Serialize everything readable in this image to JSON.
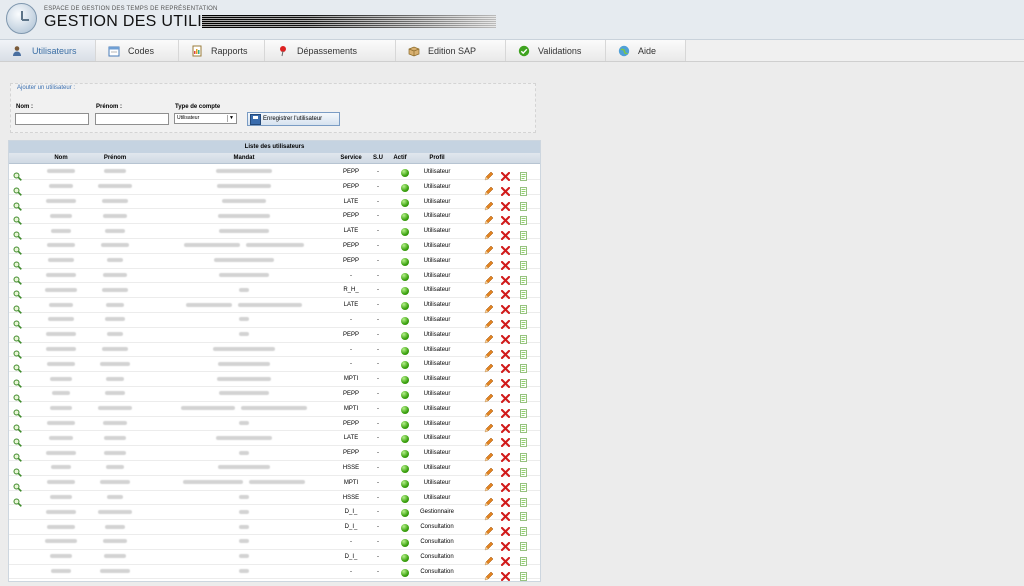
{
  "app": {
    "subtitle": "ESPACE DE GESTION DES TEMPS DE REPRÉSENTATION",
    "title": "GESTION DES UTILISAT"
  },
  "tabs": [
    {
      "label": "Utilisateurs",
      "icon": "users-icon",
      "active": true
    },
    {
      "label": "Codes",
      "icon": "calendar-icon",
      "active": false
    },
    {
      "label": "Rapports",
      "icon": "report-icon",
      "active": false
    },
    {
      "label": "Dépassements",
      "icon": "pushpin-icon",
      "active": false
    },
    {
      "label": "Edition SAP",
      "icon": "box-icon",
      "active": false
    },
    {
      "label": "Validations",
      "icon": "check-icon",
      "active": false
    },
    {
      "label": "Aide",
      "icon": "help-globe-icon",
      "active": false
    }
  ],
  "add_user": {
    "legend": "Ajouter un utilisateur :",
    "nom_label": "Nom :",
    "prenom_label": "Prénom :",
    "account_type_label": "Type de compte",
    "account_type_value": "Utilisateur",
    "save_label": "Enregistrer l'utilisateur"
  },
  "list": {
    "title": "Liste des utilisateurs",
    "columns": [
      "Nom",
      "Prénom",
      "Mandat",
      "Service",
      "S.U",
      "Actif",
      "Profil"
    ],
    "rows": [
      {
        "service": "PEPP",
        "su": "-",
        "profil": "Utilisateur",
        "view": true,
        "mandat": "---",
        "m": 1
      },
      {
        "service": "PEPP",
        "su": "-",
        "profil": "Utilisateur",
        "view": true,
        "mandat": "---",
        "m": 1
      },
      {
        "service": "LATE",
        "su": "-",
        "profil": "Utilisateur",
        "view": true,
        "mandat": "---",
        "m": 1
      },
      {
        "service": "PEPP",
        "su": "-",
        "profil": "Utilisateur",
        "view": true,
        "mandat": "---",
        "m": 1
      },
      {
        "service": "LATE",
        "su": "-",
        "profil": "Utilisateur",
        "view": true,
        "mandat": "---",
        "m": 1
      },
      {
        "service": "PEPP",
        "su": "-",
        "profil": "Utilisateur",
        "view": true,
        "mandat": "---",
        "m": 2
      },
      {
        "service": "PEPP",
        "su": "-",
        "profil": "Utilisateur",
        "view": true,
        "mandat": "---",
        "m": 1
      },
      {
        "service": "-",
        "su": "-",
        "profil": "Utilisateur",
        "view": true,
        "mandat": "---",
        "m": 1
      },
      {
        "service": "R_H_",
        "su": "-",
        "profil": "Utilisateur",
        "view": true,
        "mandat": "---",
        "m": 0
      },
      {
        "service": "LATE",
        "su": "-",
        "profil": "Utilisateur",
        "view": true,
        "mandat": "---",
        "m": 2
      },
      {
        "service": "-",
        "su": "-",
        "profil": "Utilisateur",
        "view": true,
        "mandat": "---",
        "m": 0
      },
      {
        "service": "PEPP",
        "su": "-",
        "profil": "Utilisateur",
        "view": true,
        "mandat": "---",
        "m": 0
      },
      {
        "service": "-",
        "su": "-",
        "profil": "Utilisateur",
        "view": true,
        "mandat": "---",
        "m": 1
      },
      {
        "service": "-",
        "su": "-",
        "profil": "Utilisateur",
        "view": true,
        "mandat": "---",
        "m": 1
      },
      {
        "service": "MPTI",
        "su": "-",
        "profil": "Utilisateur",
        "view": true,
        "mandat": "---",
        "m": 1
      },
      {
        "service": "PEPP",
        "su": "-",
        "profil": "Utilisateur",
        "view": true,
        "mandat": "---",
        "m": 1
      },
      {
        "service": "MPTI",
        "su": "-",
        "profil": "Utilisateur",
        "view": true,
        "mandat": "---",
        "m": 2
      },
      {
        "service": "PEPP",
        "su": "-",
        "profil": "Utilisateur",
        "view": true,
        "mandat": "---",
        "m": 0
      },
      {
        "service": "LATE",
        "su": "-",
        "profil": "Utilisateur",
        "view": true,
        "mandat": "---",
        "m": 1
      },
      {
        "service": "PEPP",
        "su": "-",
        "profil": "Utilisateur",
        "view": true,
        "mandat": "---",
        "m": 0
      },
      {
        "service": "HSSE",
        "su": "-",
        "profil": "Utilisateur",
        "view": true,
        "mandat": "---",
        "m": 1
      },
      {
        "service": "MPTI",
        "su": "-",
        "profil": "Utilisateur",
        "view": true,
        "mandat": "---",
        "m": 2
      },
      {
        "service": "HSSE",
        "su": "-",
        "profil": "Utilisateur",
        "view": true,
        "mandat": "---",
        "m": 0
      },
      {
        "service": "D_I_",
        "su": "-",
        "profil": "Gestionnaire",
        "view": false,
        "mandat": "---",
        "m": 0
      },
      {
        "service": "D_I_",
        "su": "-",
        "profil": "Consultation",
        "view": false,
        "mandat": "---",
        "m": 0
      },
      {
        "service": "-",
        "su": "-",
        "profil": "Consultation",
        "view": false,
        "mandat": "---",
        "m": 0
      },
      {
        "service": "D_I_",
        "su": "-",
        "profil": "Consultation",
        "view": false,
        "mandat": "---",
        "m": 0
      },
      {
        "service": "-",
        "su": "-",
        "profil": "Consultation",
        "view": false,
        "mandat": "---",
        "m": 0
      }
    ]
  },
  "colors": {
    "accent": "#3c6fa5",
    "active_green": "#3ba20f",
    "delete_red": "#d11a1a",
    "edit_orange": "#e3831f"
  }
}
